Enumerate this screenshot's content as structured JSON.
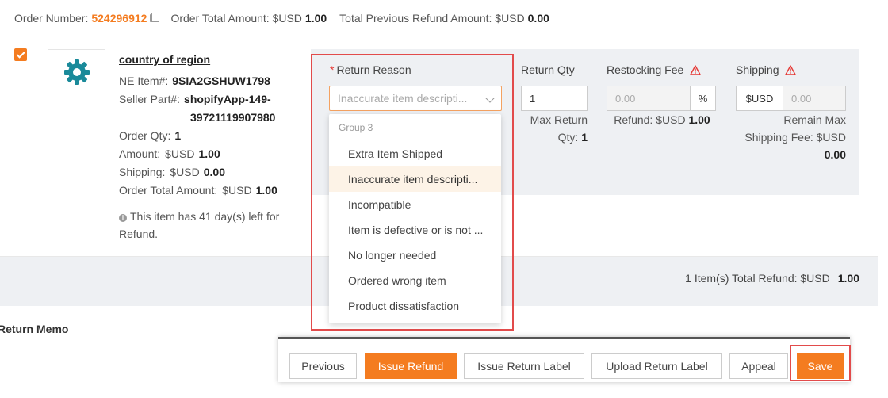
{
  "order": {
    "number_label": "Order Number:",
    "number": "524296912",
    "total_label": "Order Total Amount: $USD",
    "total": "1.00",
    "prev_refund_label": "Total Previous Refund Amount: $USD",
    "prev_refund": "0.00"
  },
  "item": {
    "title": "country of region",
    "ne_item_label": "NE Item#:",
    "ne_item": "9SIA2GSHUW1798",
    "seller_part_label": "Seller Part#:",
    "seller_part_1": "shopifyApp-149-",
    "seller_part_2": "39721119907980",
    "order_qty_label": "Order Qty:",
    "order_qty": "1",
    "amount_label": "Amount:",
    "amount_unit": "$USD",
    "amount": "1.00",
    "shipping_label": "Shipping:",
    "shipping_unit": "$USD",
    "shipping": "0.00",
    "order_total_label": "Order Total Amount:",
    "order_total_unit": "$USD",
    "order_total": "1.00",
    "notice_1": "This item has 41 day(s) left for",
    "notice_2": "Refund."
  },
  "detail": {
    "return_reason_label": "Return Reason",
    "return_reason_required": "*",
    "return_reason_placeholder": "Inaccurate item descripti...",
    "return_qty_label": "Return Qty",
    "return_qty_value": "1",
    "max_return_label_1": "Max Return",
    "max_return_label_2": "Qty:",
    "max_return_value": "1",
    "restocking_label": "Restocking Fee",
    "restocking_value": "0.00",
    "restocking_unit": "%",
    "restocking_refund_label": "Refund: $USD",
    "restocking_refund_value": "1.00",
    "shipping_label": "Shipping",
    "shipping_currency": "$USD",
    "shipping_value": "0.00",
    "remain_max_1": "Remain Max",
    "remain_max_2": "Shipping Fee: $USD",
    "remain_max_value": "0.00"
  },
  "dropdown": {
    "group_label": "Group 3",
    "options": [
      {
        "label": "Extra Item Shipped"
      },
      {
        "label": "Inaccurate item descripti..."
      },
      {
        "label": "Incompatible"
      },
      {
        "label": "Item is defective or is not ..."
      },
      {
        "label": "No longer needed"
      },
      {
        "label": "Ordered wrong item"
      },
      {
        "label": "Product dissatisfaction"
      }
    ],
    "selected_index": 1
  },
  "total": {
    "label": "1 Item(s) Total Refund: $USD",
    "value": "1.00"
  },
  "return_memo_label": "Return Memo",
  "actions": {
    "previous": "Previous",
    "issue_refund": "Issue Refund",
    "issue_return_label": "Issue Return Label",
    "upload_return_label": "Upload Return Label",
    "appeal": "Appeal",
    "save": "Save"
  },
  "colors": {
    "accent": "#f47c20",
    "highlight": "#e24b4b",
    "panel": "#eef0f3",
    "gear": "#1a8a9a"
  }
}
